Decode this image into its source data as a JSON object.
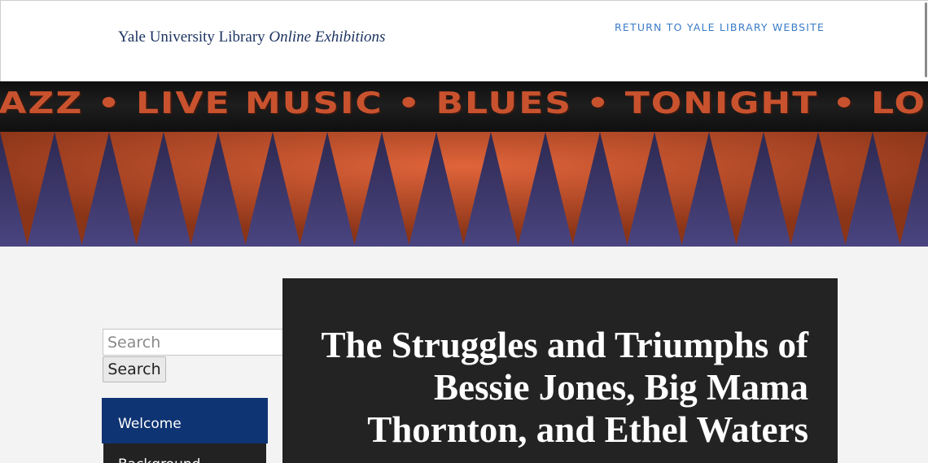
{
  "header": {
    "site_title_main": "Yale University Library",
    "site_title_italic": "Online Exhibitions",
    "return_link": "RETURN TO YALE LIBRARY WEBSITE"
  },
  "banner": {
    "marquee_text": "JAZZ • LIVE MUSIC • BLUES • TONIGHT • LOUNGE",
    "colors": {
      "orange": "#c9522e",
      "navy": "#3a3566",
      "dark": "#1a1a1a"
    }
  },
  "sidebar": {
    "search": {
      "placeholder": "Search",
      "button_label": "Search"
    },
    "nav_items": [
      {
        "label": "Welcome",
        "active": true
      },
      {
        "label": "Background"
      }
    ]
  },
  "main": {
    "title_lines": [
      "The Struggles and Triumphs of",
      "Bessie Jones, Big Mama",
      "Thornton, and Ethel Waters"
    ]
  },
  "colors": {
    "accent": "#0f3473",
    "link": "#3a7bc8",
    "card_bg": "#232323"
  }
}
